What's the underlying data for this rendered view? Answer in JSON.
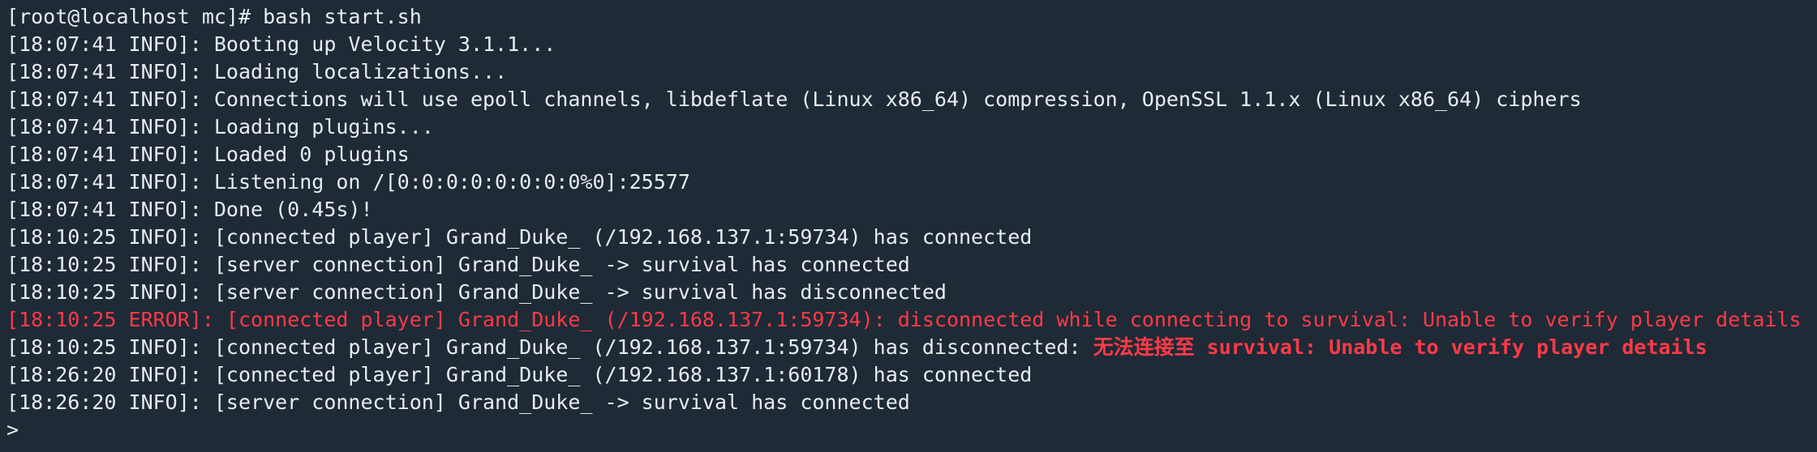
{
  "terminal": {
    "command_line": "[root@localhost mc]# bash start.sh",
    "lines": [
      {
        "text": "[18:07:41 INFO]: Booting up Velocity 3.1.1...",
        "level": "info"
      },
      {
        "text": "[18:07:41 INFO]: Loading localizations...",
        "level": "info"
      },
      {
        "text": "[18:07:41 INFO]: Connections will use epoll channels, libdeflate (Linux x86_64) compression, OpenSSL 1.1.x (Linux x86_64) ciphers",
        "level": "info"
      },
      {
        "text": "[18:07:41 INFO]: Loading plugins...",
        "level": "info"
      },
      {
        "text": "[18:07:41 INFO]: Loaded 0 plugins",
        "level": "info"
      },
      {
        "text": "[18:07:41 INFO]: Listening on /[0:0:0:0:0:0:0:0%0]:25577",
        "level": "info"
      },
      {
        "text": "[18:07:41 INFO]: Done (0.45s)!",
        "level": "info"
      },
      {
        "text": "[18:10:25 INFO]: [connected player] Grand_Duke_ (/192.168.137.1:59734) has connected",
        "level": "info"
      },
      {
        "text": "[18:10:25 INFO]: [server connection] Grand_Duke_ -> survival has connected",
        "level": "info"
      },
      {
        "text": "[18:10:25 INFO]: [server connection] Grand_Duke_ -> survival has disconnected",
        "level": "info"
      },
      {
        "text": "[18:10:25 ERROR]: [connected player] Grand_Duke_ (/192.168.137.1:59734): disconnected while connecting to survival: Unable to verify player details",
        "level": "error"
      }
    ],
    "mixed_line": {
      "prefix": "[18:10:25 INFO]: [connected player] Grand_Duke_ (/192.168.137.1:59734) has disconnected: ",
      "error_part": "无法连接至 survival: Unable to verify player details"
    },
    "tail_lines": [
      {
        "text": "[18:26:20 INFO]: [connected player] Grand_Duke_ (/192.168.137.1:60178) has connected",
        "level": "info"
      },
      {
        "text": "[18:26:20 INFO]: [server connection] Grand_Duke_ -> survival has connected",
        "level": "info"
      }
    ],
    "prompt": ">",
    "colors": {
      "background": "#1e2a36",
      "text": "#e8ecef",
      "error": "#ff3a48"
    }
  }
}
